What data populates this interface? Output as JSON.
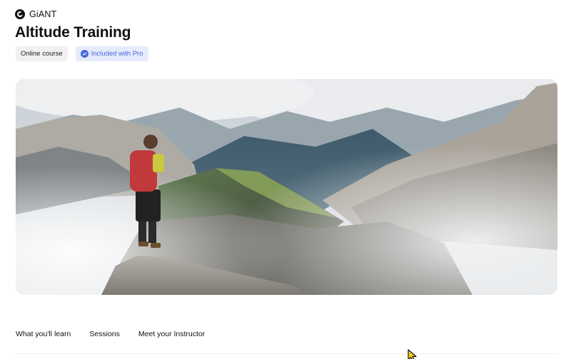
{
  "brand": {
    "name": "GiANT",
    "logo_icon": "giant-logo-icon"
  },
  "course": {
    "title": "Altitude Training"
  },
  "badges": {
    "online": "Online course",
    "pro": "Included with Pro",
    "pro_icon": "check-circle-icon",
    "pro_color": "#4966e0",
    "pro_bg": "#e6ebfc"
  },
  "hero": {
    "image": "hiker-on-mountain-ridge-image"
  },
  "tabs": [
    {
      "label": "What you'll learn"
    },
    {
      "label": "Sessions"
    },
    {
      "label": "Meet your Instructor"
    }
  ]
}
